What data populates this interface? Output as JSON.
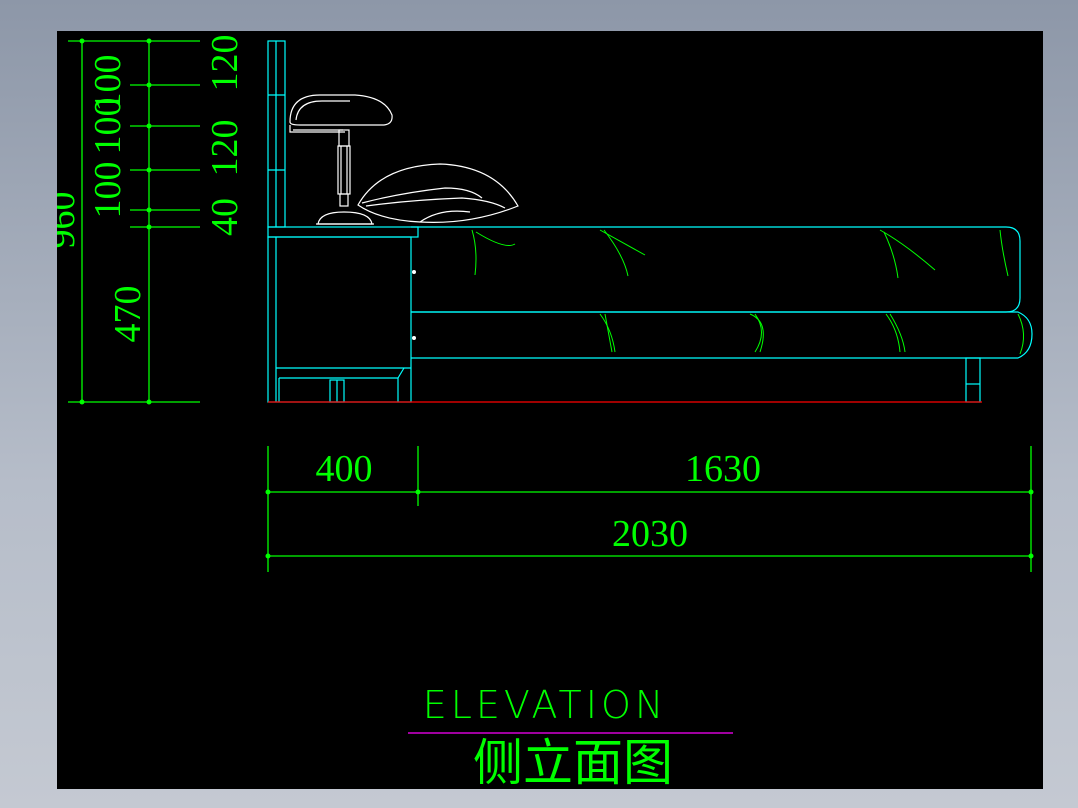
{
  "drawing": {
    "title_en": "ELEVATION",
    "title_cn": "侧立面图",
    "colors": {
      "background": "#000000",
      "dimension": "#00ff00",
      "furniture": "#00ffff",
      "detail": "#ffffff",
      "floor_line": "#ff0000",
      "title_underline": "#ff00ff"
    }
  },
  "vertical_dims": {
    "total": "960",
    "lower": "470",
    "segments_left": [
      "100",
      "100",
      "100"
    ],
    "segments_right": [
      "120",
      "120",
      "40"
    ]
  },
  "horizontal_dims": {
    "nightstand": "400",
    "bed": "1630",
    "total": "2030"
  }
}
